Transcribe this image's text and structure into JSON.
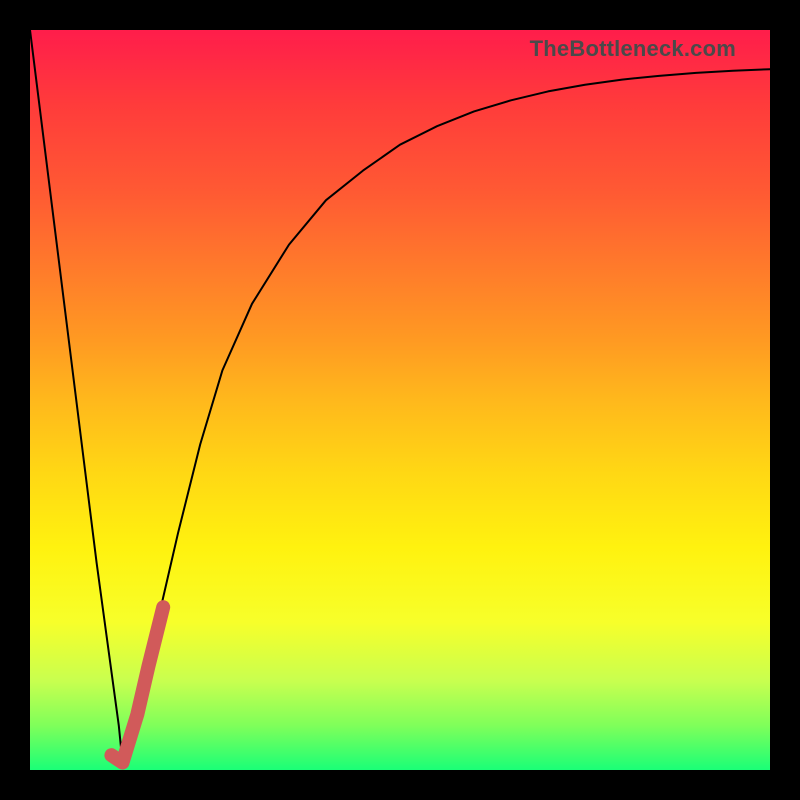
{
  "brand_label": "TheBottleneck.com",
  "colors": {
    "frame_bg": "#000000",
    "curve_stroke": "#000000",
    "marker_stroke": "#d15a5a"
  },
  "chart_data": {
    "type": "line",
    "title": "",
    "xlabel": "",
    "ylabel": "",
    "x_range": [
      0,
      100
    ],
    "y_range": [
      0,
      100
    ],
    "grid": false,
    "series": [
      {
        "name": "bottleneck-curve",
        "x": [
          0,
          3,
          6,
          9,
          12,
          12.5,
          14,
          17,
          20,
          23,
          26,
          30,
          35,
          40,
          45,
          50,
          55,
          60,
          65,
          70,
          75,
          80,
          85,
          90,
          95,
          100
        ],
        "y": [
          100,
          76,
          52,
          28,
          6,
          1,
          6,
          19,
          32,
          44,
          54,
          63,
          71,
          77,
          81,
          84.5,
          87,
          89,
          90.5,
          91.7,
          92.6,
          93.3,
          93.8,
          94.2,
          94.5,
          94.7
        ]
      }
    ],
    "annotations": [
      {
        "name": "highlight-segment",
        "type": "polyline",
        "points_x": [
          11.0,
          12.5,
          14.5,
          16.0,
          18.0
        ],
        "points_y": [
          2.0,
          1.0,
          7.5,
          14.0,
          22.0
        ]
      }
    ]
  }
}
